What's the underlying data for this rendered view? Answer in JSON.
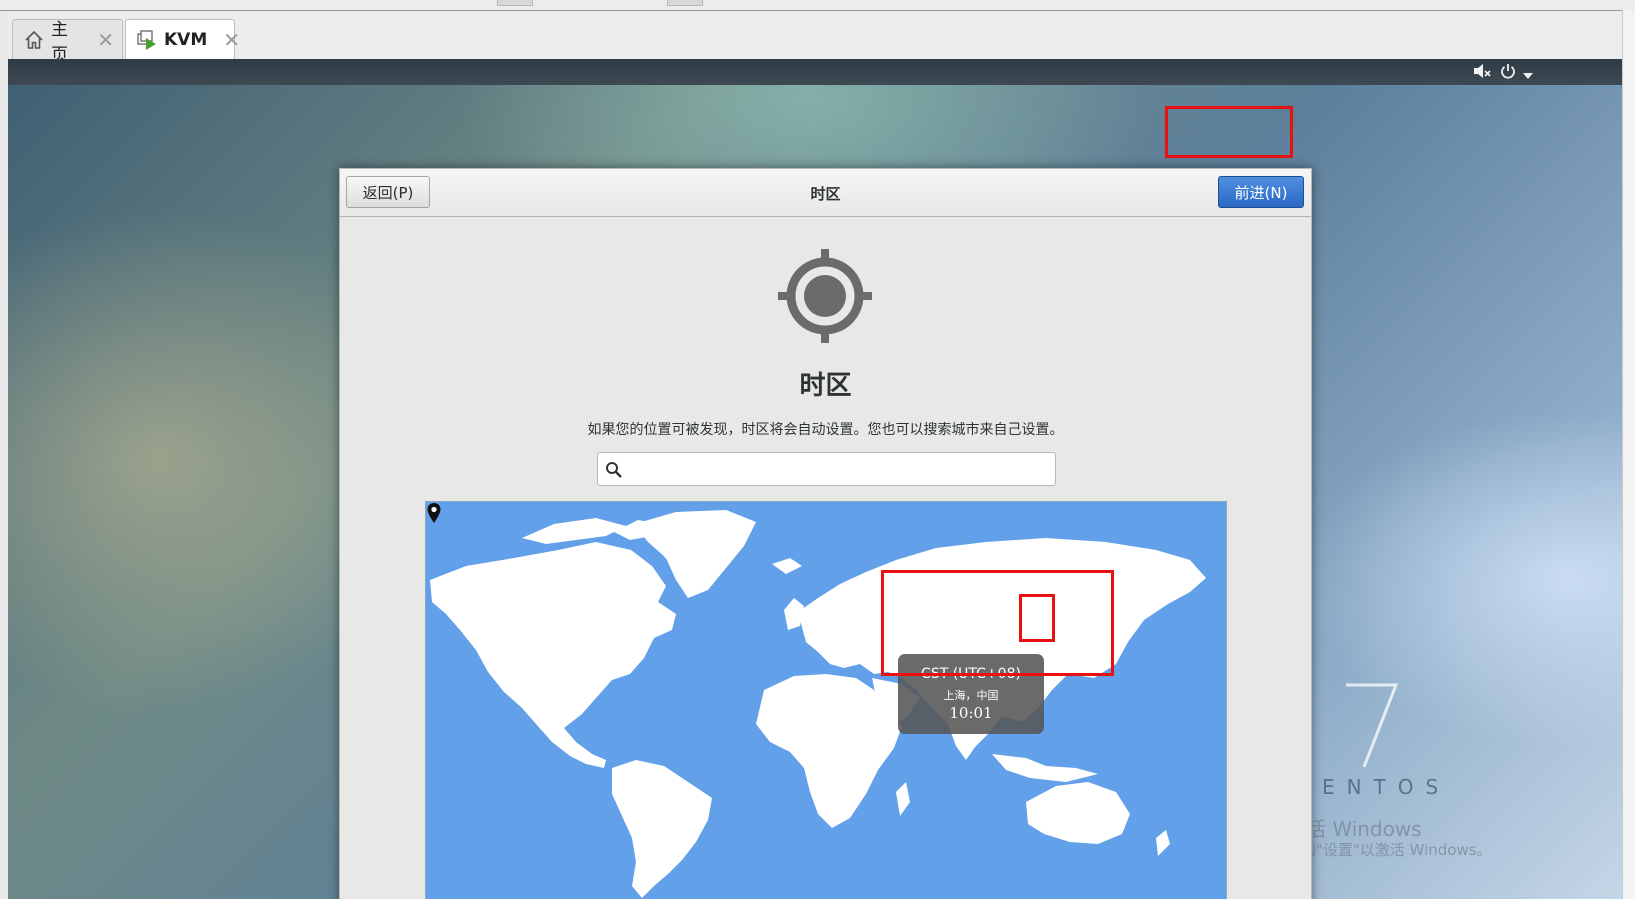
{
  "tabs": [
    {
      "label": "主页",
      "icon": "home-icon",
      "active": false
    },
    {
      "label": "KVM",
      "icon": "vm-icon",
      "active": true
    }
  ],
  "vm_topbar": {
    "volume_icon": "volume-muted-icon",
    "power_icon": "power-icon",
    "menu_icon": "chevron-down-icon"
  },
  "dialog": {
    "header_title": "时区",
    "back_label": "返回(P)",
    "next_label": "前进(N)",
    "page_title": "时区",
    "description": "如果您的位置可被发现，时区将会自动设置。您也可以搜索城市来自己设置。",
    "search": {
      "value": "",
      "placeholder": ""
    }
  },
  "map": {
    "timezone": "CST (UTC+08)",
    "city": "上海，中国",
    "time": "10:01",
    "colors": {
      "ocean": "#62a0ea",
      "land": "#ffffff"
    }
  },
  "desktop": {
    "brand_number": "7",
    "brand_name": "CENTOS",
    "activation_line1": "激活 Windows",
    "activation_line2": "转到\"设置\"以激活 Windows。"
  },
  "annotations": {
    "color": "#e81010"
  }
}
